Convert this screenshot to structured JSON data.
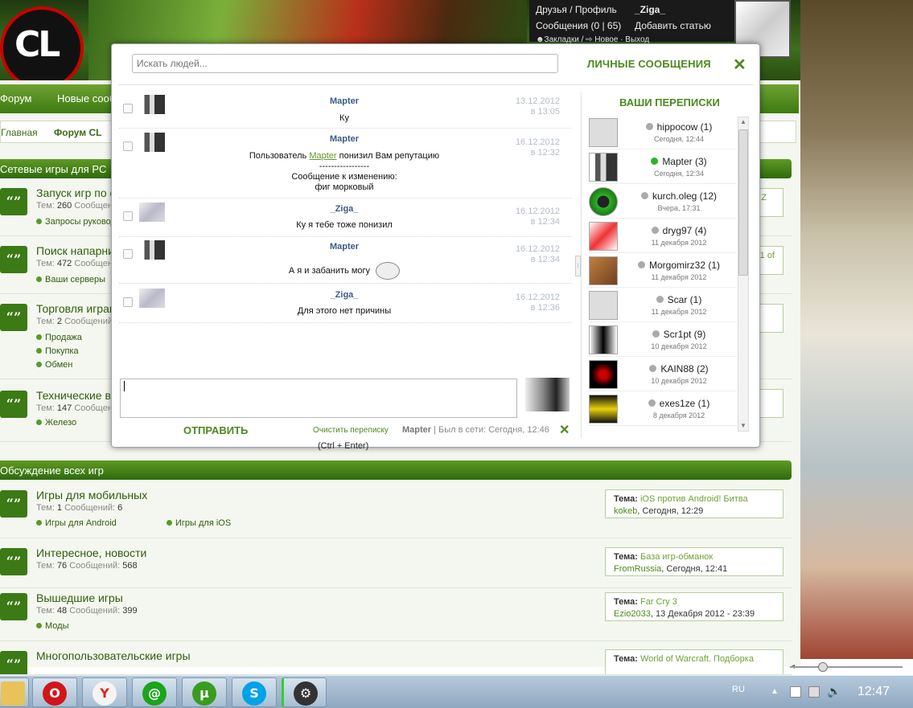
{
  "header": {
    "logo_text": "CL",
    "user_links": {
      "friends": "Друзья / Профиль",
      "username": "_Ziga_",
      "messages": "Сообщения (0 | 65)",
      "add_article": "Добавить статью",
      "bookmarks": "☻Закладки / ⇨ Новое · Выход"
    }
  },
  "nav": {
    "items": [
      "Форум",
      "Новые сообщения"
    ]
  },
  "breadcrumbs": [
    "Главная",
    "Форум CL"
  ],
  "sections": [
    {
      "title": "Сетевые игры для PC",
      "forums": [
        {
          "title": "Запуск игр по сети",
          "stats": {
            "themes_label": "Тем:",
            "themes": "260",
            "msgs_label": "Сообщений:",
            "msgs": ""
          },
          "subs": [
            "Запросы руководств"
          ],
          "last": "Z"
        },
        {
          "title": "Поиск напарников",
          "stats": {
            "themes_label": "Тем:",
            "themes": "472",
            "msgs_label": "Сообщений:",
            "msgs": ""
          },
          "subs": [
            "Ваши серверы"
          ],
          "last": "1 of"
        },
        {
          "title": "Торговля играми",
          "stats": {
            "themes_label": "Тем:",
            "themes": "2",
            "msgs_label": "Сообщений:",
            "msgs": ""
          },
          "subs": [
            "Продажа",
            "Покупка",
            "Обмен"
          ]
        },
        {
          "title": "Технические вопросы",
          "stats": {
            "themes_label": "Тем:",
            "themes": "147",
            "msgs_label": "Сообщений:",
            "msgs": ""
          },
          "subs": [
            "Железо"
          ]
        }
      ]
    },
    {
      "title": "Обсуждение всех игр",
      "forums": [
        {
          "title": "Игры для мобильных",
          "stats": {
            "themes_label": "Тем:",
            "themes": "1",
            "msgs_label": "Сообщений:",
            "msgs": "6"
          },
          "subs": [
            "Игры для Android",
            "Игры для iOS"
          ],
          "last": {
            "label": "Тема:",
            "topic": "iOS против Android! Битва",
            "user": "kokeb",
            "when": ", Сегодня, 12:29"
          }
        },
        {
          "title": "Интересное, новости",
          "stats": {
            "themes_label": "Тем:",
            "themes": "76",
            "msgs_label": "Сообщений:",
            "msgs": "568"
          },
          "subs": [],
          "last": {
            "label": "Тема:",
            "topic": "База игр-обманок",
            "user": "FromRussia",
            "when": ", Сегодня, 12:41"
          }
        },
        {
          "title": "Вышедшие игры",
          "stats": {
            "themes_label": "Тем:",
            "themes": "48",
            "msgs_label": "Сообщений:",
            "msgs": "399"
          },
          "subs": [
            "Моды"
          ],
          "last": {
            "label": "Тема:",
            "topic": "Far Cry 3",
            "user": "Ezio2033",
            "when": ", 13 Декабря 2012 - 23:39"
          }
        },
        {
          "title": "Многопользовательские игры",
          "stats": {},
          "subs": [],
          "last": {
            "label": "Тема:",
            "topic": "World of Warcraft. Подборка",
            "user": "",
            "when": ""
          }
        }
      ]
    }
  ],
  "modal": {
    "search_placeholder": "Искать людей...",
    "title": "ЛИЧНЫЕ СООБЩЕНИЯ",
    "close": "✕",
    "messages": [
      {
        "author": "Mapter",
        "text": [
          "Ку"
        ],
        "date": "13.12.2012",
        "time": "в 13:05",
        "avatar": "man"
      },
      {
        "author": "Mapter",
        "text_pre": "Пользователь ",
        "text_link": "Mapter",
        "text_post": " понизил Вам репутацию",
        "text": [
          "-----------------",
          "Сообщение к изменению:",
          "фиг морковый"
        ],
        "date": "16.12.2012",
        "time": "в 12:32",
        "avatar": "man"
      },
      {
        "author": "_Ziga_",
        "text": [
          "Ку я тебе тоже понизил"
        ],
        "date": "16.12.2012",
        "time": "в 12:34",
        "avatar": "tiger"
      },
      {
        "author": "Mapter",
        "text": [
          "А я и забанить могу"
        ],
        "date": "16.12.2012",
        "time": "в 12:34",
        "avatar": "man"
      },
      {
        "author": "_Ziga_",
        "text": [
          "Для этого нет причины"
        ],
        "date": "16.12.2012",
        "time": "в 12:36",
        "avatar": "tiger"
      }
    ],
    "send": "ОТПРАВИТЬ",
    "send_hint": "(Ctrl + Enter)",
    "clear": "Очистить переписку",
    "status_user": "Mapter",
    "status_text": " | Был в сети: Сегодня, 12:46",
    "conversations_title": "ВАШИ ПЕРЕПИСКИ",
    "conversations": [
      {
        "name": "hippocow (1)",
        "date": "Сегодня, 12:44",
        "online": false
      },
      {
        "name": "Mapter (3)",
        "date": "Сегодня, 12:34",
        "online": true
      },
      {
        "name": "kurch.oleg (12)",
        "date": "Вчера, 17:31",
        "online": false
      },
      {
        "name": "dryg97 (4)",
        "date": "11 декабря 2012",
        "online": false
      },
      {
        "name": "Morgomirz32 (1)",
        "date": "11 декабря 2012",
        "online": false
      },
      {
        "name": "Scar (1)",
        "date": "11 декабря 2012",
        "online": false
      },
      {
        "name": "Scr1pt (9)",
        "date": "10 декабря 2012",
        "online": false
      },
      {
        "name": "KAIN88 (2)",
        "date": "10 декабря 2012",
        "online": false
      },
      {
        "name": "exes1ze (1)",
        "date": "8 декабря 2012",
        "online": false
      }
    ]
  },
  "taskbar": {
    "lang": "RU",
    "clock": "12:47"
  },
  "colors": {
    "accent": "#4b8a1e",
    "nav": "#3d7a12",
    "author": "#3a5c85"
  }
}
